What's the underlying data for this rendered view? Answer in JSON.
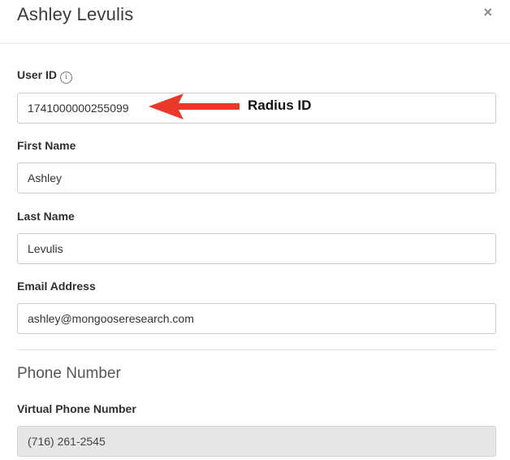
{
  "dialog": {
    "title": "Ashley Levulis",
    "close_label": "×"
  },
  "fields": {
    "user_id": {
      "label": "User ID",
      "info_icon": "info-icon",
      "value": "1741000000255099"
    },
    "first_name": {
      "label": "First Name",
      "value": "Ashley"
    },
    "last_name": {
      "label": "Last Name",
      "value": "Levulis"
    },
    "email": {
      "label": "Email Address",
      "value": "ashley@mongooseresearch.com"
    }
  },
  "phone_section": {
    "title": "Phone Number",
    "virtual_phone": {
      "label": "Virtual Phone Number",
      "value": "(716) 261-2545"
    }
  },
  "annotation": {
    "text": "Radius ID",
    "arrow_color": "#e8392a"
  }
}
